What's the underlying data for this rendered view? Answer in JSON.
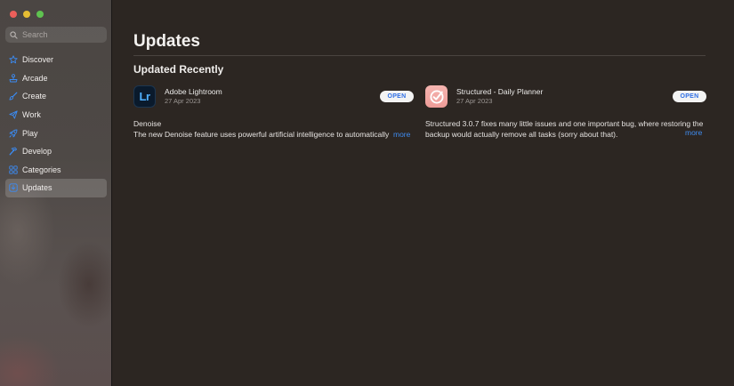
{
  "sidebar": {
    "search_placeholder": "Search",
    "items": [
      {
        "label": "Discover",
        "icon": "star-icon"
      },
      {
        "label": "Arcade",
        "icon": "joystick-icon"
      },
      {
        "label": "Create",
        "icon": "brush-icon"
      },
      {
        "label": "Work",
        "icon": "paper-plane-icon"
      },
      {
        "label": "Play",
        "icon": "rocket-icon"
      },
      {
        "label": "Develop",
        "icon": "hammer-icon"
      },
      {
        "label": "Categories",
        "icon": "grid-icon"
      },
      {
        "label": "Updates",
        "icon": "download-icon",
        "active": true
      }
    ]
  },
  "main": {
    "title": "Updates",
    "section_title": "Updated Recently",
    "apps": [
      {
        "name": "Adobe Lightroom",
        "date": "27 Apr 2023",
        "button": "OPEN",
        "icon_text": "Lr",
        "notes_title": "Denoise",
        "notes_body": "The new Denoise feature uses powerful artificial intelligence to automatically",
        "more": "more"
      },
      {
        "name": "Structured - Daily Planner",
        "date": "27 Apr 2023",
        "button": "OPEN",
        "notes_body": "Structured 3.0.7 fixes many little issues and one important bug, where restoring the backup would actually remove all tasks (sorry about that).",
        "more": "more"
      }
    ]
  },
  "colors": {
    "accent": "#3f8cf0",
    "window_bg": "#2c2622",
    "sidebar_bg": "#4e4946"
  }
}
